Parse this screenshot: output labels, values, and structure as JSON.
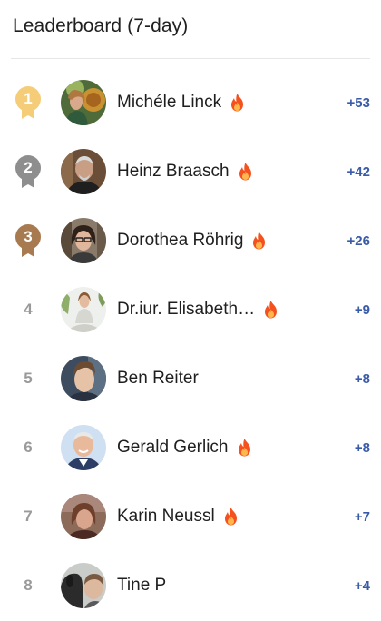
{
  "header": {
    "title": "Leaderboard (7-day)"
  },
  "colors": {
    "gold": "#f5cd78",
    "silver": "#8e8e8e",
    "bronze": "#a87a50",
    "score": "#3a5ba7",
    "flame_outer": "#f4511e",
    "flame_inner": "#ffb74d"
  },
  "entries": [
    {
      "rank": "1",
      "name": "Michéle Linck",
      "score": "+53",
      "flame": true,
      "medal": "gold"
    },
    {
      "rank": "2",
      "name": "Heinz Braasch",
      "score": "+42",
      "flame": true,
      "medal": "silver"
    },
    {
      "rank": "3",
      "name": "Dorothea Röhrig",
      "score": "+26",
      "flame": true,
      "medal": "bronze"
    },
    {
      "rank": "4",
      "name": "Dr.iur. Elisabeth…",
      "score": "+9",
      "flame": true
    },
    {
      "rank": "5",
      "name": "Ben Reiter",
      "score": "+8",
      "flame": false
    },
    {
      "rank": "6",
      "name": "Gerald Gerlich",
      "score": "+8",
      "flame": true
    },
    {
      "rank": "7",
      "name": "Karin Neussl",
      "score": "+7",
      "flame": true
    },
    {
      "rank": "8",
      "name": "Tine P",
      "score": "+4",
      "flame": false
    }
  ]
}
